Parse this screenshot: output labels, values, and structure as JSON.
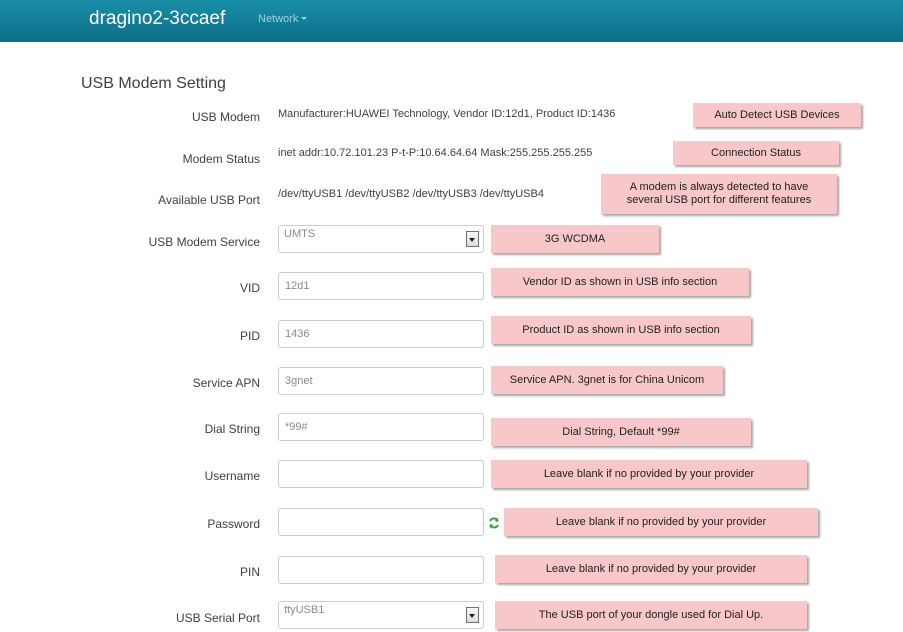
{
  "header": {
    "brand": "dragino2-3ccaef",
    "nav_menu": "Network"
  },
  "section_title": "USB Modem Setting",
  "rows": {
    "usb_modem": {
      "label": "USB Modem",
      "value": "Manufacturer:HUAWEI Technology, Vendor ID:12d1, Product ID:1436",
      "note": "Auto Detect USB Devices"
    },
    "modem_status": {
      "label": "Modem Status",
      "value": "inet addr:10.72.101.23 P-t-P:10.64.64.64 Mask:255.255.255.255",
      "note": "Connection Status"
    },
    "available_port": {
      "label": "Available USB Port",
      "value": "/dev/ttyUSB1 /dev/ttyUSB2 /dev/ttyUSB3 /dev/ttyUSB4",
      "note_line1": "A modem is always detected to have",
      "note_line2": "several USB port for different features"
    },
    "modem_service": {
      "label": "USB Modem Service",
      "selected": "UMTS",
      "note": "3G WCDMA"
    },
    "vid": {
      "label": "VID",
      "value": "12d1",
      "note": "Vendor ID as shown in USB info section"
    },
    "pid": {
      "label": "PID",
      "value": "1436",
      "note": "Product ID as shown in USB info section"
    },
    "apn": {
      "label": "Service APN",
      "value": "3gnet",
      "note": "Service APN. 3gnet is for China Unicom"
    },
    "dial": {
      "label": "Dial String",
      "value": "*99#",
      "note": "Dial String, Default *99#"
    },
    "username": {
      "label": "Username",
      "value": "",
      "note": "Leave blank if no provided by your provider"
    },
    "password": {
      "label": "Password",
      "value": "",
      "note": "Leave blank if no provided by your provider"
    },
    "pin": {
      "label": "PIN",
      "value": "",
      "note": "Leave blank if no provided by your provider"
    },
    "serial_port": {
      "label": "USB Serial Port",
      "selected": "ttyUSB1",
      "note": "The USB port of your dongle used for Dial Up."
    }
  }
}
